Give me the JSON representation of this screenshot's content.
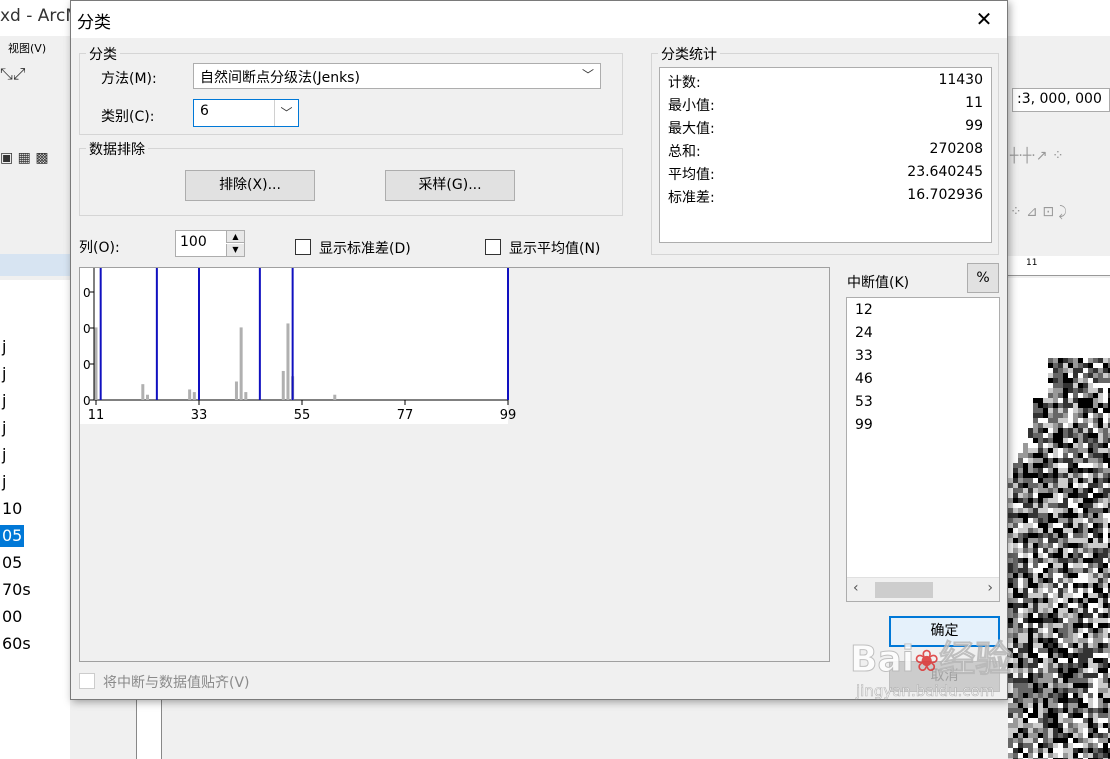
{
  "background": {
    "app_title": "xd - ArcM",
    "menu_view": "视图(V)",
    "scale": ":3, 000, 000",
    "left_items": [
      "j",
      "j",
      "j",
      "j",
      "j",
      "j",
      "10",
      "05",
      "05",
      "70s",
      "00",
      "60s"
    ],
    "left_selected_index": 7,
    "ruler_tick": "11"
  },
  "dialog": {
    "title": "分类",
    "classification": {
      "group_label": "分类",
      "method_label": "方法(M):",
      "method_value": "自然间断点分级法(Jenks)",
      "classes_label": "类别(C):",
      "classes_value": "6"
    },
    "exclusion": {
      "group_label": "数据排除",
      "exclude_button": "排除(X)...",
      "sampling_button": "采样(G)..."
    },
    "statistics": {
      "group_label": "分类统计",
      "rows": [
        {
          "label": "计数:",
          "value": "11430"
        },
        {
          "label": "最小值:",
          "value": "11"
        },
        {
          "label": "最大值:",
          "value": "99"
        },
        {
          "label": "总和:",
          "value": "270208"
        },
        {
          "label": "平均值:",
          "value": "23.640245"
        },
        {
          "label": "标准差:",
          "value": "16.702936"
        }
      ]
    },
    "columns_label": "列(O):",
    "columns_value": "100",
    "show_std_label": "显示标准差(D)",
    "show_mean_label": "显示平均值(N)",
    "breaks_label": "中断值(K)",
    "percent_button": "%",
    "break_values": [
      "12",
      "24",
      "33",
      "46",
      "53",
      "99"
    ],
    "ok_button": "确定",
    "cancel_button": "取消",
    "snap_label": "将中断与数据值贴齐(V)"
  },
  "chart_data": {
    "type": "bar",
    "xlim": [
      11,
      99
    ],
    "x_ticks": [
      "11",
      "33",
      "55",
      "77",
      "99"
    ],
    "y_tick_label": "0",
    "y_ticks_count": 4,
    "bars": [
      {
        "x": 11,
        "h": 0.55
      },
      {
        "x": 21,
        "h": 0.12
      },
      {
        "x": 22,
        "h": 0.04
      },
      {
        "x": 31,
        "h": 0.08
      },
      {
        "x": 32,
        "h": 0.06
      },
      {
        "x": 41,
        "h": 0.14
      },
      {
        "x": 42,
        "h": 0.55
      },
      {
        "x": 43,
        "h": 0.06
      },
      {
        "x": 51,
        "h": 0.22
      },
      {
        "x": 52,
        "h": 0.58
      },
      {
        "x": 53,
        "h": 0.18
      },
      {
        "x": 62,
        "h": 0.04
      }
    ],
    "breaks": [
      12,
      24,
      33,
      46,
      53,
      99
    ],
    "grid": false
  },
  "watermark": {
    "brand": "Bai",
    "brand_cn": "经验",
    "url": "jingyan.baidu.com"
  }
}
